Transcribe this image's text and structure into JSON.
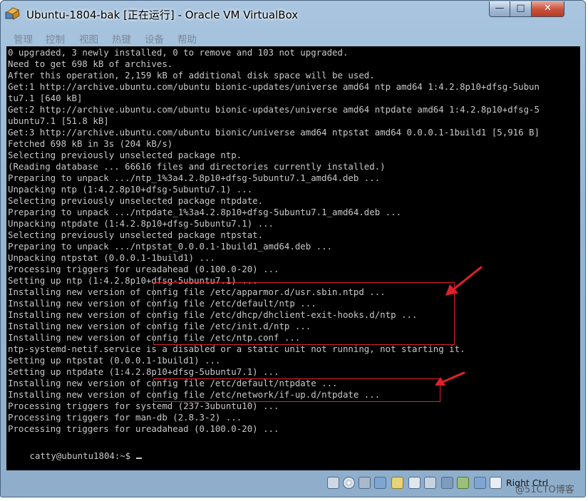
{
  "window": {
    "title": "Ubuntu-1804-bak [正在运行] - Oracle VM VirtualBox",
    "min_symbol": "—",
    "max_symbol": "□",
    "close_symbol": "✕"
  },
  "menu": {
    "items": [
      "管理",
      "控制",
      "视图",
      "热键",
      "设备",
      "帮助"
    ]
  },
  "terminal": {
    "lines": [
      "0 upgraded, 3 newly installed, 0 to remove and 103 not upgraded.",
      "Need to get 698 kB of archives.",
      "After this operation, 2,159 kB of additional disk space will be used.",
      "Get:1 http://archive.ubuntu.com/ubuntu bionic-updates/universe amd64 ntp amd64 1:4.2.8p10+dfsg-5ubun",
      "tu7.1 [640 kB]",
      "Get:2 http://archive.ubuntu.com/ubuntu bionic-updates/universe amd64 ntpdate amd64 1:4.2.8p10+dfsg-5",
      "ubuntu7.1 [51.8 kB]",
      "Get:3 http://archive.ubuntu.com/ubuntu bionic/universe amd64 ntpstat amd64 0.0.0.1-1build1 [5,916 B]",
      "Fetched 698 kB in 3s (204 kB/s)",
      "Selecting previously unselected package ntp.",
      "(Reading database ... 66616 files and directories currently installed.)",
      "Preparing to unpack .../ntp_1%3a4.2.8p10+dfsg-5ubuntu7.1_amd64.deb ...",
      "Unpacking ntp (1:4.2.8p10+dfsg-5ubuntu7.1) ...",
      "Selecting previously unselected package ntpdate.",
      "Preparing to unpack .../ntpdate_1%3a4.2.8p10+dfsg-5ubuntu7.1_amd64.deb ...",
      "Unpacking ntpdate (1:4.2.8p10+dfsg-5ubuntu7.1) ...",
      "Selecting previously unselected package ntpstat.",
      "Preparing to unpack .../ntpstat_0.0.0.1-1build1_amd64.deb ...",
      "Unpacking ntpstat (0.0.0.1-1build1) ...",
      "Processing triggers for ureadahead (0.100.0-20) ...",
      "Setting up ntp (1:4.2.8p10+dfsg-5ubuntu7.1) ...",
      "Installing new version of config file /etc/apparmor.d/usr.sbin.ntpd ...",
      "Installing new version of config file /etc/default/ntp ...",
      "Installing new version of config file /etc/dhcp/dhclient-exit-hooks.d/ntp ...",
      "Installing new version of config file /etc/init.d/ntp ...",
      "Installing new version of config file /etc/ntp.conf ...",
      "ntp-systemd-netif.service is a disabled or a static unit not running, not starting it.",
      "Setting up ntpstat (0.0.0.1-1build1) ...",
      "Setting up ntpdate (1:4.2.8p10+dfsg-5ubuntu7.1) ...",
      "Installing new version of config file /etc/default/ntpdate ...",
      "Installing new version of config file /etc/network/if-up.d/ntpdate ...",
      "Processing triggers for systemd (237-3ubuntu10) ...",
      "Processing triggers for man-db (2.8.3-2) ...",
      "Processing triggers for ureadahead (0.100.0-20) ...",
      "catty@ubuntu1804:~$ "
    ]
  },
  "annotation": {
    "color": "#e0202a"
  },
  "statusbar": {
    "icons": [
      "hard-disk-icon",
      "optical-disk-icon",
      "usb-icon",
      "network-icon",
      "shared-folder-icon",
      "display-icon",
      "video-capture-icon",
      "virtualization-icon",
      "mouse-integration-icon",
      "keyboard-capture-icon"
    ],
    "host_key": "Right Ctrl"
  },
  "watermark": {
    "text": "@51CTO博客"
  }
}
